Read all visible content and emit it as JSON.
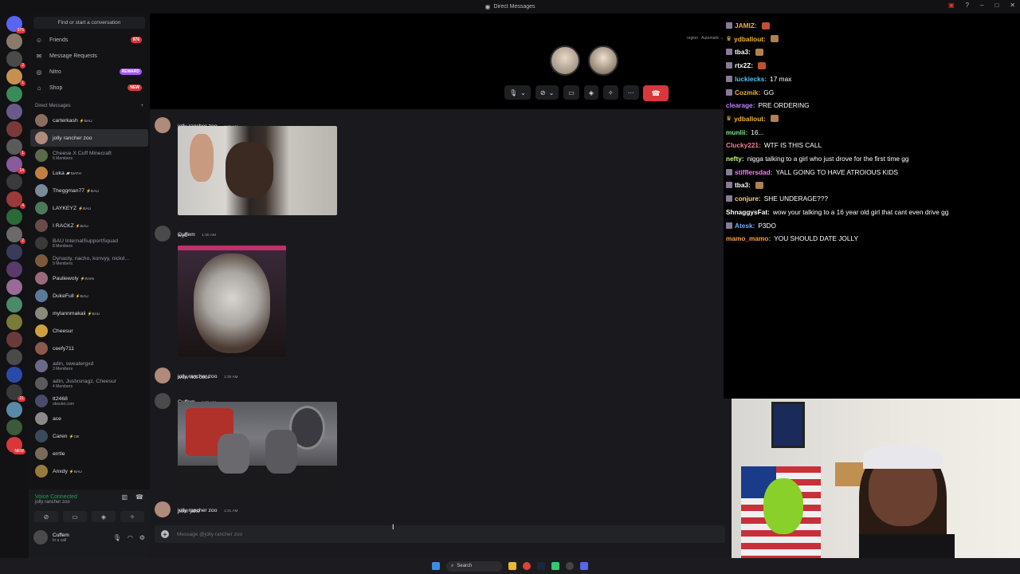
{
  "titlebar": {
    "title": "Direct Messages"
  },
  "sidebar": {
    "search_placeholder": "Find or start a conversation",
    "nav": [
      {
        "label": "Friends",
        "badge": "976",
        "icon": "friends-icon"
      },
      {
        "label": "Message Requests",
        "badge": "",
        "icon": "mail-icon"
      },
      {
        "label": "Nitro",
        "badge": "REWARD",
        "icon": "nitro-icon"
      },
      {
        "label": "Shop",
        "badge": "NEW",
        "icon": "shop-icon"
      }
    ],
    "dm_header": "Direct Messages",
    "dm_add": "+",
    "dms": [
      {
        "name": "carterkash",
        "tag": "⚡BAU",
        "sub": "",
        "color": "#8a6d5c"
      },
      {
        "name": "jolly rancher zoo",
        "tag": "",
        "sub": "",
        "color": "#b08a7a"
      },
      {
        "name": "Cheese X Cuff Minecraft",
        "tag": "",
        "sub": "6 Members",
        "color": "#5a6a4a"
      },
      {
        "name": "Luka",
        "tag": "🪐MATH",
        "sub": "",
        "color": "#c08040"
      },
      {
        "name": "Theggman77",
        "tag": "⚡BAU",
        "sub": "",
        "color": "#7a8a9a"
      },
      {
        "name": "LAYKEYZ",
        "tag": "⚡BAU",
        "sub": "",
        "color": "#4a7a5a"
      },
      {
        "name": "I RACKZ",
        "tag": "⚡BAU",
        "sub": "",
        "color": "#6a4a4a"
      },
      {
        "name": "BAU InternalSupportSquad",
        "tag": "",
        "sub": "8 Members",
        "color": "#3a3a3a"
      },
      {
        "name": "Dynasty, nacho, konvyy, nickd...",
        "tag": "",
        "sub": "9 Members",
        "color": "#7a5a3a"
      },
      {
        "name": "Pauliewoly",
        "tag": "⚡RAIN",
        "sub": "",
        "color": "#9a6a7a"
      },
      {
        "name": "DukeFull",
        "tag": "⚡BAU",
        "sub": "",
        "color": "#5a7a9a"
      },
      {
        "name": "mylannmakaii",
        "tag": "⚡BAU",
        "sub": "",
        "color": "#8a8a7a"
      },
      {
        "name": "Cheesur",
        "tag": "",
        "sub": "",
        "color": "#d0a040"
      },
      {
        "name": "ceefy711",
        "tag": "",
        "sub": "",
        "color": "#8a5a4a"
      },
      {
        "name": "adin, sweatergxd",
        "tag": "",
        "sub": "3 Members",
        "color": "#6a6a8a"
      },
      {
        "name": "adin, Justxsnagz, Cheesur",
        "tag": "",
        "sub": "4 Members",
        "color": "#5a5a5a"
      },
      {
        "name": "tt2468",
        "tag": "",
        "sub": "obsolet.com",
        "color": "#4a4a6a"
      },
      {
        "name": "ace",
        "tag": "",
        "sub": "",
        "color": "#8a8a8a"
      },
      {
        "name": "Caren",
        "tag": "⚡CB",
        "sub": "",
        "color": "#3a4a5a"
      },
      {
        "name": "errtle",
        "tag": "",
        "sub": "",
        "color": "#7a6a5a"
      },
      {
        "name": "Anxdy",
        "tag": "⚡BAU",
        "sub": "",
        "color": "#9a7a3a"
      }
    ],
    "voice": {
      "status": "Voice Connected",
      "channel": "jolly rancher zoo"
    },
    "user": {
      "name": "Cuffem",
      "status": "In a call"
    }
  },
  "guilds": [
    {
      "color": "#5865f2",
      "badge": "976"
    },
    {
      "color": "#8a7a6a",
      "badge": ""
    },
    {
      "color": "#4a4a4a",
      "badge": "2"
    },
    {
      "color": "#c89050",
      "badge": "1"
    },
    {
      "color": "#3a8a5a",
      "badge": ""
    },
    {
      "color": "#6a5a8a",
      "badge": ""
    },
    {
      "color": "#7a3a3a",
      "badge": ""
    },
    {
      "color": "#5a5a5a",
      "badge": "1"
    },
    {
      "color": "#8a5a9a",
      "badge": "14"
    },
    {
      "color": "#3a3a3a",
      "badge": ""
    },
    {
      "color": "#9a3a3a",
      "badge": "4"
    },
    {
      "color": "#2a6a3a",
      "badge": ""
    },
    {
      "color": "#6a6a6a",
      "badge": "2"
    },
    {
      "color": "#3a3a5a",
      "badge": ""
    },
    {
      "color": "#5a3a6a",
      "badge": ""
    },
    {
      "color": "#9a6a9a",
      "badge": ""
    },
    {
      "color": "#4a8a6a",
      "badge": ""
    },
    {
      "color": "#7a7a3a",
      "badge": ""
    },
    {
      "color": "#6a3a3a",
      "badge": ""
    },
    {
      "color": "#4a4a4a",
      "badge": ""
    },
    {
      "color": "#2a4aaa",
      "badge": ""
    },
    {
      "color": "#3a3a3a",
      "badge": "21"
    },
    {
      "color": "#5a8aaa",
      "badge": ""
    },
    {
      "color": "#3a5a3a",
      "badge": ""
    },
    {
      "color": "#da373c",
      "badge": "NEW"
    }
  ],
  "call": {
    "region_label": "region",
    "region_value": "Automatic"
  },
  "messages": [
    {
      "author": "jolly rancher zoo",
      "time": "1:29 AM",
      "text": "",
      "avatar": "#b08a7a"
    },
    {
      "author": "Cuffem",
      "time": "1:30 AM",
      "text": "wyd",
      "avatar": "#4a4a4a"
    },
    {
      "author": "jolly rancher zoo",
      "time": "1:30 AM",
      "text": "wow not cool",
      "avatar": "#b08a7a"
    },
    {
      "author": "Cuffem",
      "time": "1:30 AM",
      "text": "",
      "avatar": "#4a4a4a"
    },
    {
      "author": "jolly rancher zoo",
      "time": "1:31 AM",
      "text": "poor jake",
      "avatar": "#b08a7a"
    }
  ],
  "composer": {
    "placeholder": "Message @jolly rancher zoo"
  },
  "stream_chat": [
    {
      "user": "JAMIZ",
      "msg": "",
      "color": "#f0b232",
      "badge": "sub",
      "emote": "#c05030"
    },
    {
      "user": "ydballout",
      "msg": "",
      "color": "#f0b232",
      "badge": "crown",
      "emote": "#b08050"
    },
    {
      "user": "tba3",
      "msg": "",
      "color": "#ffffff",
      "badge": "sub",
      "emote": "#b08050"
    },
    {
      "user": "rtx2Z",
      "msg": "",
      "color": "#ffffff",
      "badge": "sub",
      "emote": "#c05030"
    },
    {
      "user": "luckiecks",
      "msg": "17 max",
      "color": "#4fc3f7",
      "badge": "sub",
      "emote": ""
    },
    {
      "user": "Cozmik",
      "msg": "GG",
      "color": "#f0b232",
      "badge": "sub",
      "emote": ""
    },
    {
      "user": "clearage",
      "msg": "PRE ORDERING",
      "color": "#c084fc",
      "badge": "",
      "emote": ""
    },
    {
      "user": "ydballout",
      "msg": "",
      "color": "#f0b232",
      "badge": "crown",
      "emote": "#b08050"
    },
    {
      "user": "munlii",
      "msg": "16...",
      "color": "#7ee787",
      "badge": "",
      "emote": ""
    },
    {
      "user": "Clucky221",
      "msg": "WTF IS THIS CALL",
      "color": "#ff7b9c",
      "badge": "",
      "emote": ""
    },
    {
      "user": "nefty",
      "msg": "nigga talking to a girl who just drove for the first time gg",
      "color": "#c6ff7a",
      "badge": "",
      "emote": ""
    },
    {
      "user": "stifflersdad",
      "msg": "YALL GOING TO HAVE ATROIOUS KIDS",
      "color": "#ff7bff",
      "badge": "sub",
      "emote": ""
    },
    {
      "user": "tba3",
      "msg": "",
      "color": "#ffffff",
      "badge": "sub",
      "emote": "#b08050"
    },
    {
      "user": "conjure",
      "msg": "SHE UNDERAGE???",
      "color": "#ffd27a",
      "badge": "sub",
      "emote": ""
    },
    {
      "user": "ShnaggysFat",
      "msg": "wow your talking to a 16 year old girl that cant even drive gg",
      "color": "#ffffff",
      "badge": "",
      "emote": ""
    },
    {
      "user": "Atesk",
      "msg": "P3DO",
      "color": "#7aa8ff",
      "badge": "sub",
      "emote": ""
    },
    {
      "user": "mamo_mamo",
      "msg": "YOU SHOULD DATE JOLLY",
      "color": "#ff9f43",
      "badge": "",
      "emote": ""
    }
  ],
  "taskbar": {
    "search_label": "Search"
  }
}
